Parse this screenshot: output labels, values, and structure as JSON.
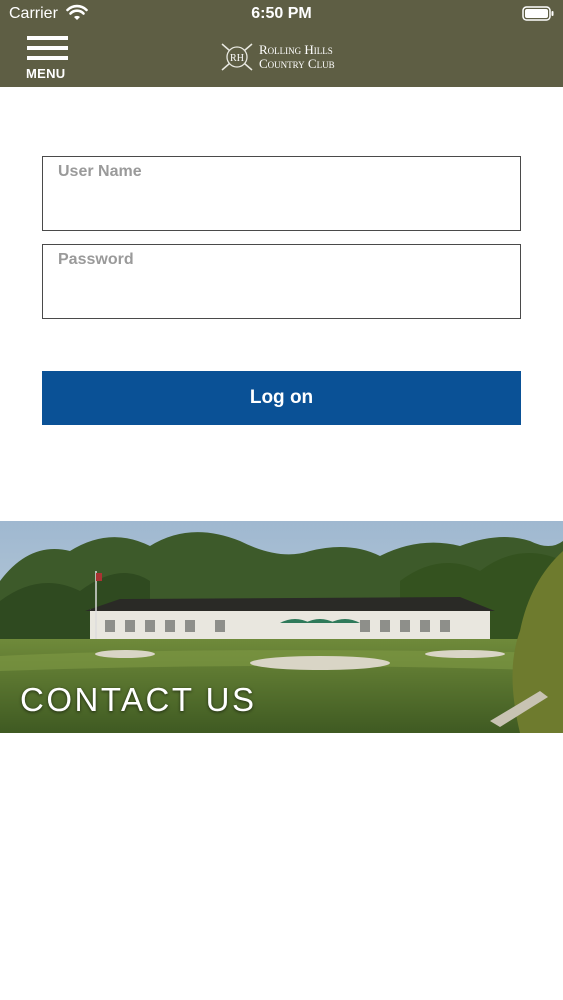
{
  "status_bar": {
    "carrier": "Carrier",
    "time": "6:50 PM"
  },
  "header": {
    "menu_label": "MENU",
    "logo": {
      "line1": "Rolling Hills",
      "line2": "Country Club",
      "monogram": "RH"
    }
  },
  "login": {
    "username_placeholder": "User Name",
    "password_placeholder": "Password",
    "logon_label": "Log on"
  },
  "contact_banner": {
    "label": "CONTACT US"
  },
  "colors": {
    "header_bg": "#5e5e44",
    "button_bg": "#0a5196",
    "field_border": "#4a4a4a",
    "placeholder": "#9a9a9a"
  },
  "icons": [
    "wifi-icon",
    "battery-icon",
    "menu-icon",
    "club-emblem-icon"
  ]
}
